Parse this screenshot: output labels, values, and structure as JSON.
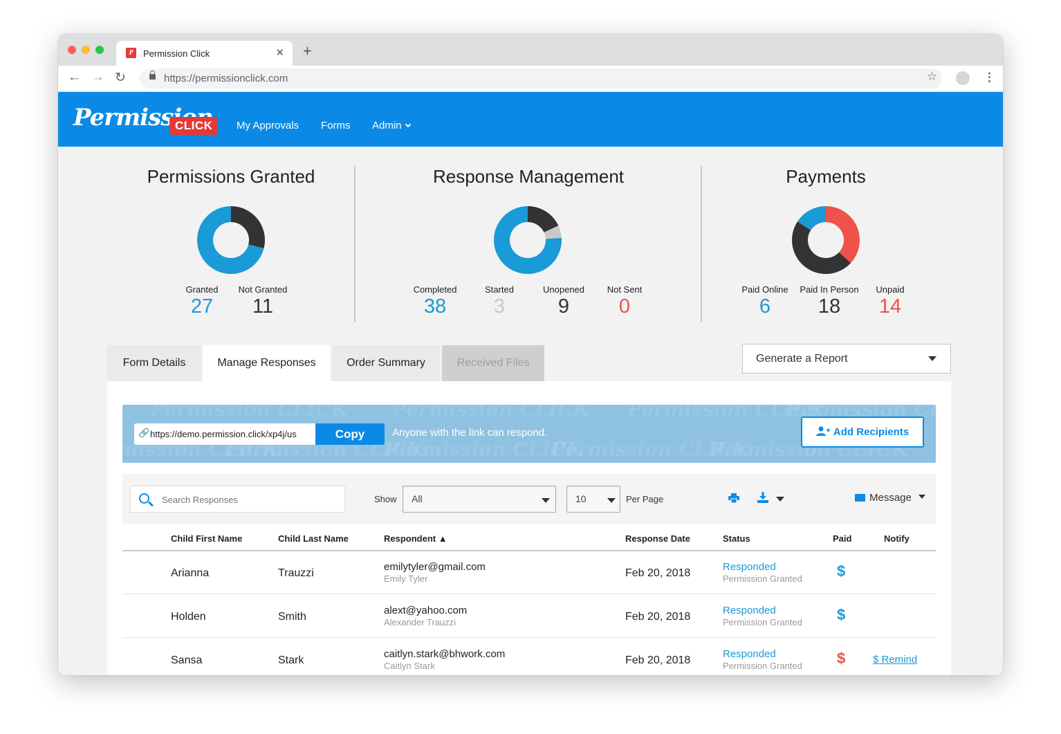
{
  "browser": {
    "tab_title": "Permission Click",
    "favicon_letter": "P",
    "url": "https://permissionclick.com"
  },
  "app": {
    "logo_script": "Permission",
    "logo_badge": "CLICK",
    "nav": [
      "My Approvals",
      "Forms",
      "Admin"
    ]
  },
  "colors": {
    "brand_blue": "#0a8ae6",
    "donut_blue": "#1a9ad6",
    "donut_dark": "#333333",
    "donut_gray": "#c8c8c8",
    "red": "#ef5248"
  },
  "stats": {
    "permissions": {
      "title": "Permissions Granted",
      "items": [
        {
          "label": "Granted",
          "value": "27",
          "color": "#1a9ad6"
        },
        {
          "label": "Not Granted",
          "value": "11",
          "color": "#333333"
        }
      ]
    },
    "responses": {
      "title": "Response Management",
      "items": [
        {
          "label": "Completed",
          "value": "38",
          "color": "#1a9ad6"
        },
        {
          "label": "Started",
          "value": "3",
          "color": "#c8c8c8"
        },
        {
          "label": "Unopened",
          "value": "9",
          "color": "#333333"
        },
        {
          "label": "Not Sent",
          "value": "0",
          "color": "#ef5248"
        }
      ]
    },
    "payments": {
      "title": "Payments",
      "items": [
        {
          "label": "Paid Online",
          "value": "6",
          "color": "#1a9ad6"
        },
        {
          "label": "Paid In Person",
          "value": "18",
          "color": "#333333"
        },
        {
          "label": "Unpaid",
          "value": "14",
          "color": "#ef5248"
        }
      ]
    }
  },
  "tabs": [
    "Form Details",
    "Manage Responses",
    "Order Summary",
    "Received Files"
  ],
  "report_label": "Generate a Report",
  "banner": {
    "link": "https://demo.permission.click/xp4j/us",
    "copy_label": "Copy",
    "note": "Anyone with the link can respond.",
    "add_label": "Add Recipients"
  },
  "filters": {
    "search_placeholder": "Search Responses",
    "show_label": "Show",
    "show_value": "All",
    "count_value": "10",
    "per_page_label": "Per Page",
    "message_label": "Message"
  },
  "table": {
    "headers": [
      "Child First Name",
      "Child Last Name",
      "Respondent ▲",
      "Response Date",
      "Status",
      "Paid",
      "Notify"
    ],
    "rows": [
      {
        "first": "Arianna",
        "last": "Trauzzi",
        "email": "emilytyler@gmail.com",
        "name": "Emily Tyler",
        "date": "Feb 20, 2018",
        "status": "Responded",
        "status_sub": "Permission Granted",
        "paid": "$",
        "paid_color": "#1a9ad6",
        "notify": ""
      },
      {
        "first": "Holden",
        "last": "Smith",
        "email": "alext@yahoo.com",
        "name": "Alexander Trauzzi",
        "date": "Feb 20, 2018",
        "status": "Responded",
        "status_sub": "Permission Granted",
        "paid": "$",
        "paid_color": "#1a9ad6",
        "notify": ""
      },
      {
        "first": "Sansa",
        "last": "Stark",
        "email": "caitlyn.stark@bhwork.com",
        "name": "Caitlyn Stark",
        "date": "Feb 20, 2018",
        "status": "Responded",
        "status_sub": "Permission Granted",
        "paid": "$",
        "paid_color": "#ef5248",
        "notify": "$ Remind"
      }
    ]
  }
}
